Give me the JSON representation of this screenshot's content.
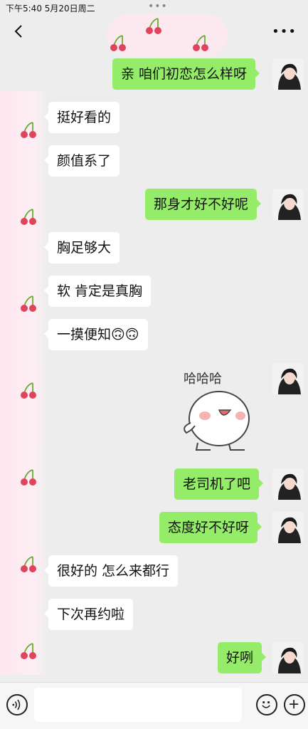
{
  "status_bar": {
    "time": "下午5:40   5月20日周二",
    "dots": "•••"
  },
  "colors": {
    "outgoing_bubble": "#95ec69",
    "incoming_bubble": "#ffffff",
    "background": "#ededed"
  },
  "icons": [
    "back-arrow-icon",
    "more-icon",
    "voice-icon",
    "emoji-icon",
    "plus-icon",
    "cherry-icon"
  ],
  "messages": [
    {
      "side": "out",
      "text": "亲 咱们初恋怎么样呀"
    },
    {
      "side": "in",
      "text": "挺好看的"
    },
    {
      "side": "in",
      "text": "颜值系了"
    },
    {
      "side": "out",
      "text": "那身才好不好呢"
    },
    {
      "side": "in",
      "text": "胸足够大"
    },
    {
      "side": "in",
      "text": "软 肯定是真胸"
    },
    {
      "side": "in",
      "text": "一摸便知🙃🙃"
    },
    {
      "side": "out",
      "type": "sticker",
      "sticker_text": "哈哈哈"
    },
    {
      "side": "out",
      "text": "老司机了吧"
    },
    {
      "side": "out",
      "text": "态度好不好呀"
    },
    {
      "side": "in",
      "text": "很好的 怎么来都行"
    },
    {
      "side": "in",
      "text": "下次再约啦"
    },
    {
      "side": "out",
      "text": "好咧"
    }
  ]
}
